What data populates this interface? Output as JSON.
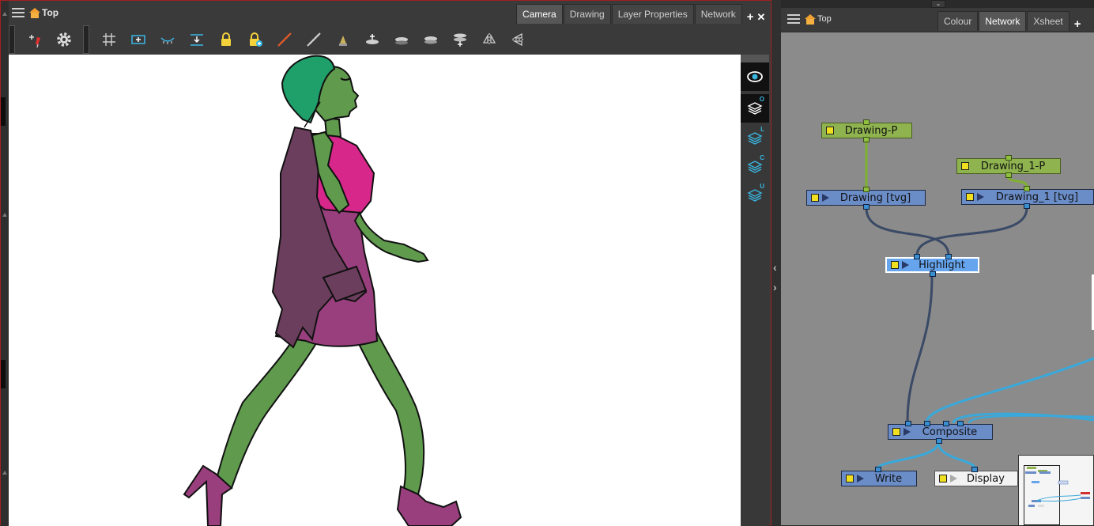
{
  "left_panel": {
    "title": "Top",
    "tabs": [
      {
        "label": "Camera",
        "active": true
      },
      {
        "label": "Drawing",
        "active": false
      },
      {
        "label": "Layer Properties",
        "active": false
      },
      {
        "label": "Network",
        "active": false
      }
    ],
    "add_symbol": "+",
    "close_symbol": "✕",
    "toolbar_icons": [
      "pen-tool-icon",
      "gear-icon",
      "grid-icon",
      "onion-skin-icon",
      "light-table-icon",
      "import-icon",
      "lock-icon",
      "lock-add-icon",
      "ruler-icon",
      "perspective-ruler-icon",
      "stamp-icon",
      "layer-add-icon",
      "layer-flat-icon",
      "layer-flat2-icon",
      "layer-stack-icon",
      "flip-horizontal-icon",
      "flip-vertical-icon"
    ],
    "view_side_buttons": [
      {
        "icon": "eye-icon",
        "letter": "",
        "active": true
      },
      {
        "icon": "layers-icon",
        "letter": "O",
        "active": true
      },
      {
        "icon": "layers-icon",
        "letter": "L",
        "active": false
      },
      {
        "icon": "layers-icon",
        "letter": "C",
        "active": false
      },
      {
        "icon": "layers-icon",
        "letter": "U",
        "active": false
      }
    ]
  },
  "right_panel": {
    "title": "Top",
    "tabs": [
      {
        "label": "Colour",
        "active": false
      },
      {
        "label": "Network",
        "active": true
      },
      {
        "label": "Xsheet",
        "active": false
      }
    ],
    "add_symbol": "+",
    "nodes": {
      "drawing_p": "Drawing-P",
      "drawing_1_p": "Drawing_1-P",
      "drawing_tvg": "Drawing [tvg]",
      "drawing_1_tvg": "Drawing_1 [tvg]",
      "highlight": "Highlight",
      "composite": "Composite",
      "write": "Write",
      "display": "Display"
    }
  },
  "colors": {
    "node_blue": "#6a8cc7",
    "node_green": "#8fb34f",
    "node_selected": "#66a4ee",
    "link_dark": "#3a4a66",
    "link_cyan": "#39a9dc",
    "link_green": "#7fb030",
    "skin": "#5f9a4d",
    "hair": "#1f9f6a",
    "top": "#d8278a",
    "skirt": "#9a3f7e",
    "jacket": "#6c3e5e"
  }
}
